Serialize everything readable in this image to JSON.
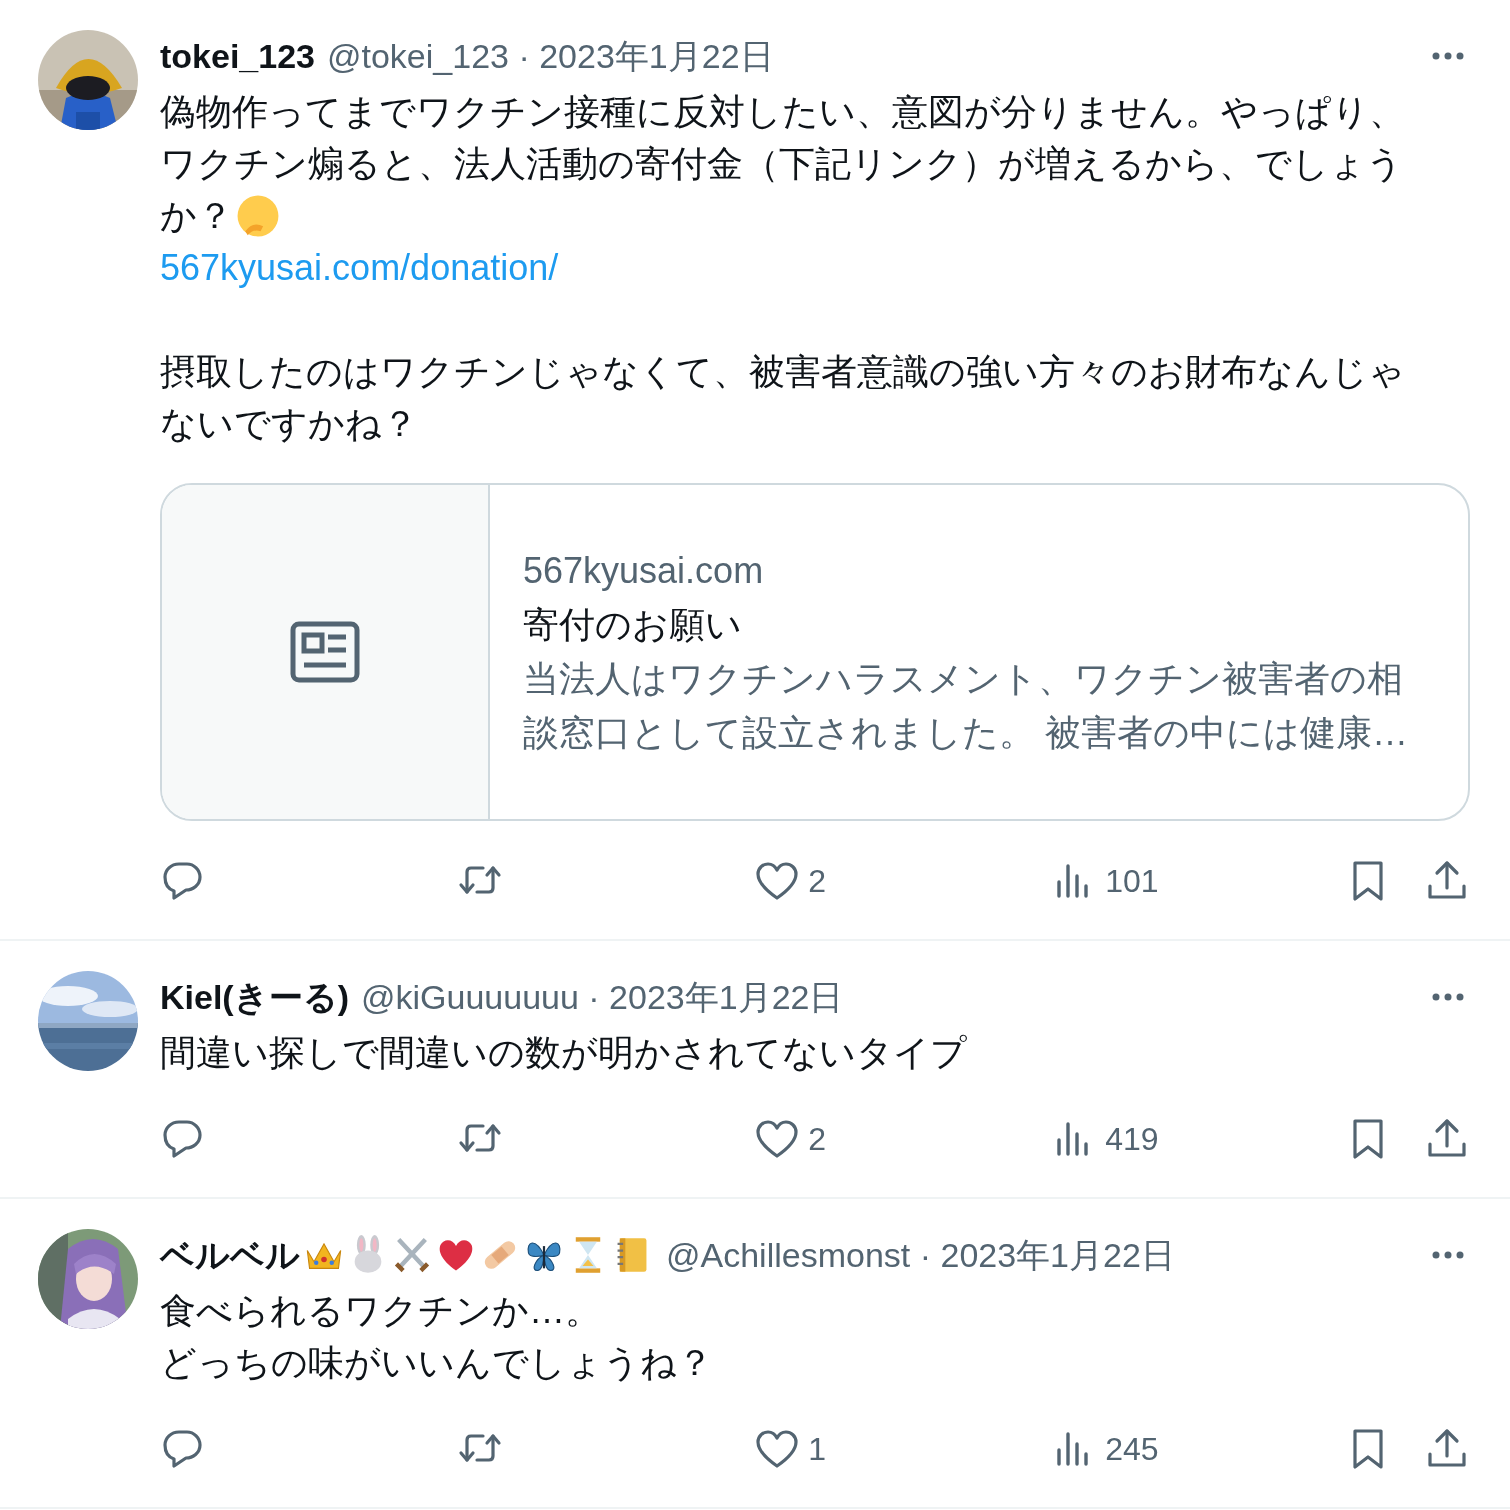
{
  "tweets": [
    {
      "display_name": "tokei_123",
      "meta": "@tokei_123 · 2023年1月22日",
      "paragraphs": [
        {
          "lines": [
            {
              "kind": "text",
              "text": "偽物作ってまでワクチン接種に反対したい、意図が分りません。やっぱり、"
            },
            {
              "kind": "text",
              "text": "ワクチン煽ると、法人活動の寄付金（下記リンク）が増えるから、でしょう"
            },
            {
              "kind": "text",
              "text": "か？"
            },
            {
              "kind": "link",
              "text": "567kyusai.com/donation/"
            }
          ]
        },
        {
          "lines": [
            {
              "kind": "text",
              "text": "摂取したのはワクチンじゃなくて、被害者意識の強い方々のお財布なんじゃ"
            },
            {
              "kind": "text",
              "text": "ないですかね？"
            }
          ]
        }
      ],
      "card": {
        "domain": "567kyusai.com",
        "title": "寄付のお願い",
        "description": [
          "当法人はワクチンハラスメント、ワクチン被害者の相",
          "談窓口として設立されました。 被害者の中には健康…"
        ]
      },
      "likes": "2",
      "views": "101"
    },
    {
      "display_name": "Kiel(きーる)",
      "meta": "@kiGuuuuuuu · 2023年1月22日",
      "paragraphs": [
        {
          "lines": [
            {
              "kind": "text",
              "text": "間違い探しで間違いの数が明かされてないタイプ"
            }
          ]
        }
      ],
      "likes": "2",
      "views": "419"
    },
    {
      "display_name": "ベルベル",
      "meta": "@Achillesmonst · 2023年1月22日",
      "paragraphs": [
        {
          "lines": [
            {
              "kind": "text",
              "text": "食べられるワクチンか…。"
            },
            {
              "kind": "text",
              "text": "どっちの味がいいんでしょうね？"
            }
          ]
        }
      ],
      "likes": "1",
      "views": "245"
    }
  ]
}
